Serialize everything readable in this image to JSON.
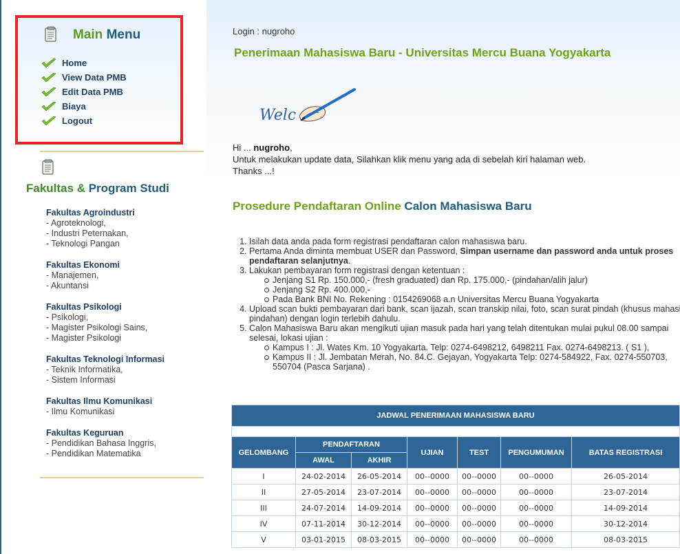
{
  "sidebar": {
    "menu_title_a": "Main",
    "menu_title_b": "Menu",
    "menu_items": [
      "Home",
      "View Data PMB",
      "Edit Data PMB",
      "Biaya",
      "Logout"
    ],
    "fakultas_title_a": "Fakultas &",
    "fakultas_title_b": "Program Studi",
    "fakultas": [
      {
        "name": "Fakultas Agroindustri",
        "programs": [
          "- Agroteknologi,",
          "- Industri Peternakan,",
          "- Teknologi Pangan"
        ]
      },
      {
        "name": "Fakultas Ekonomi",
        "programs": [
          "- Manajemen,",
          "- Akuntansi"
        ]
      },
      {
        "name": "Fakultas Psikologi",
        "programs": [
          "- Psikologi,",
          "- Magister Psikologi Sains,",
          "- Magister Psikologi"
        ]
      },
      {
        "name": "Fakultas Teknologi Informasi",
        "programs": [
          "- Teknik Informatika,",
          "- Sistem Informasi"
        ]
      },
      {
        "name": "Fakultas Ilmu Komunikasi",
        "programs": [
          "- Ilmu Komunikasi"
        ]
      },
      {
        "name": "Fakultas Keguruan",
        "programs": [
          "- Pendidikan Bahasa Inggris,",
          "- Pendidikan Matematika"
        ]
      }
    ]
  },
  "main": {
    "login_label": "Login :",
    "login_user": "nugroho",
    "headline": "Penerimaan Mahasiswa Baru - Universitas Mercu Buana Yogyakarta",
    "welcome_text": "Welc",
    "greet_hi": "Hi ...",
    "greet_user": "nugroho",
    "greet_line2": "Untuk melakukan update data, Silahkan klik menu yang ada di sebelah kiri halaman web.",
    "greet_line3": "Thanks ...!",
    "proc_title_a": "Prosedure Pendaftaran Online",
    "proc_title_b": "Calon Mahasiswa Baru",
    "steps": {
      "s1": "Isilah data anda pada form registrasi pendaftaran calon mahasiswa baru.",
      "s2a": "Pertama Anda diminta membuat USER dan Password,",
      "s2b": "Simpan username dan password anda untuk proses pendaftaran selanjutnya",
      "s3": "Lakukan pembayaran form registrasi dengan ketentuan :",
      "s3_sub": [
        "Jenjang S1 Rp. 150.000,- (fresh graduated) dan Rp. 175.000,- (pindahan/alih jalur)",
        "Jenjang S2 Rp. 400.000,-",
        "Pada Bank BNI No. Rekening : 0154269068 a.n Universitas Mercu Buana Yogyakarta"
      ],
      "s4": "Upload scan bukti pembayaran dari bank, scan ijazah, scan transkip nilai, foto, scan surat pindah (khusus mahasiswa pindahan) dengan login terlebih dahulu.",
      "s5": "Calon Mahasiswa Baru akan mengikuti ujian masuk pada hari yang telah ditentukan mulai pukul 08.00 sampai selesai, lokasi ujian :",
      "s5_sub": [
        "Kampus I : Jl. Wates Km. 10 Yogyakarta. Telp: 0274-6498212, 6498211 Fax. 0274-6498213. ( S1 ),",
        "Kampus II : Jl. Jembatan Merah, No. 84.C. Gejayan, Yogyakarta Telp: 0274-584922, Fax. 0274-550703, 550704 (Pasca Sarjana) ."
      ]
    },
    "table": {
      "caption": "JADWAL PENERIMAAN MAHASISWA BARU",
      "h_gelombang": "GELOMBANG",
      "h_pendaftaran": "PENDAFTARAN",
      "h_awal": "AWAL",
      "h_akhir": "AKHIR",
      "h_ujian": "UJIAN",
      "h_test": "TEST",
      "h_pengumuman": "PENGUMUMAN",
      "h_batas": "BATAS REGISTRASI",
      "rows": [
        [
          "I",
          "24-02-2014",
          "26-05-2014",
          "00--0000",
          "00--0000",
          "00--0000",
          "26-05-2014"
        ],
        [
          "II",
          "27-05-2014",
          "23-07-2014",
          "00--0000",
          "00--0000",
          "00--0000",
          "23-07-2014"
        ],
        [
          "III",
          "24-07-2014",
          "14-09-2014",
          "00--0000",
          "00--0000",
          "00--0000",
          "14-09-2014"
        ],
        [
          "IV",
          "07-11-2014",
          "30-12-2014",
          "00--0000",
          "00--0000",
          "00--0000",
          "30-12-2014"
        ],
        [
          "V",
          "03-01-2015",
          "08-03-2015",
          "00--0000",
          "00--0000",
          "00--0000",
          "08-03-2015"
        ]
      ]
    }
  },
  "colors": {
    "highlight_border": "#e52629",
    "green_heading": "#6fa21c",
    "teal_heading": "#1e5c7a",
    "table_header": "#2d6597",
    "link": "#1d3f66"
  },
  "icons": [
    "document-icon",
    "checkmark-icon",
    "pen-hand-icon"
  ]
}
